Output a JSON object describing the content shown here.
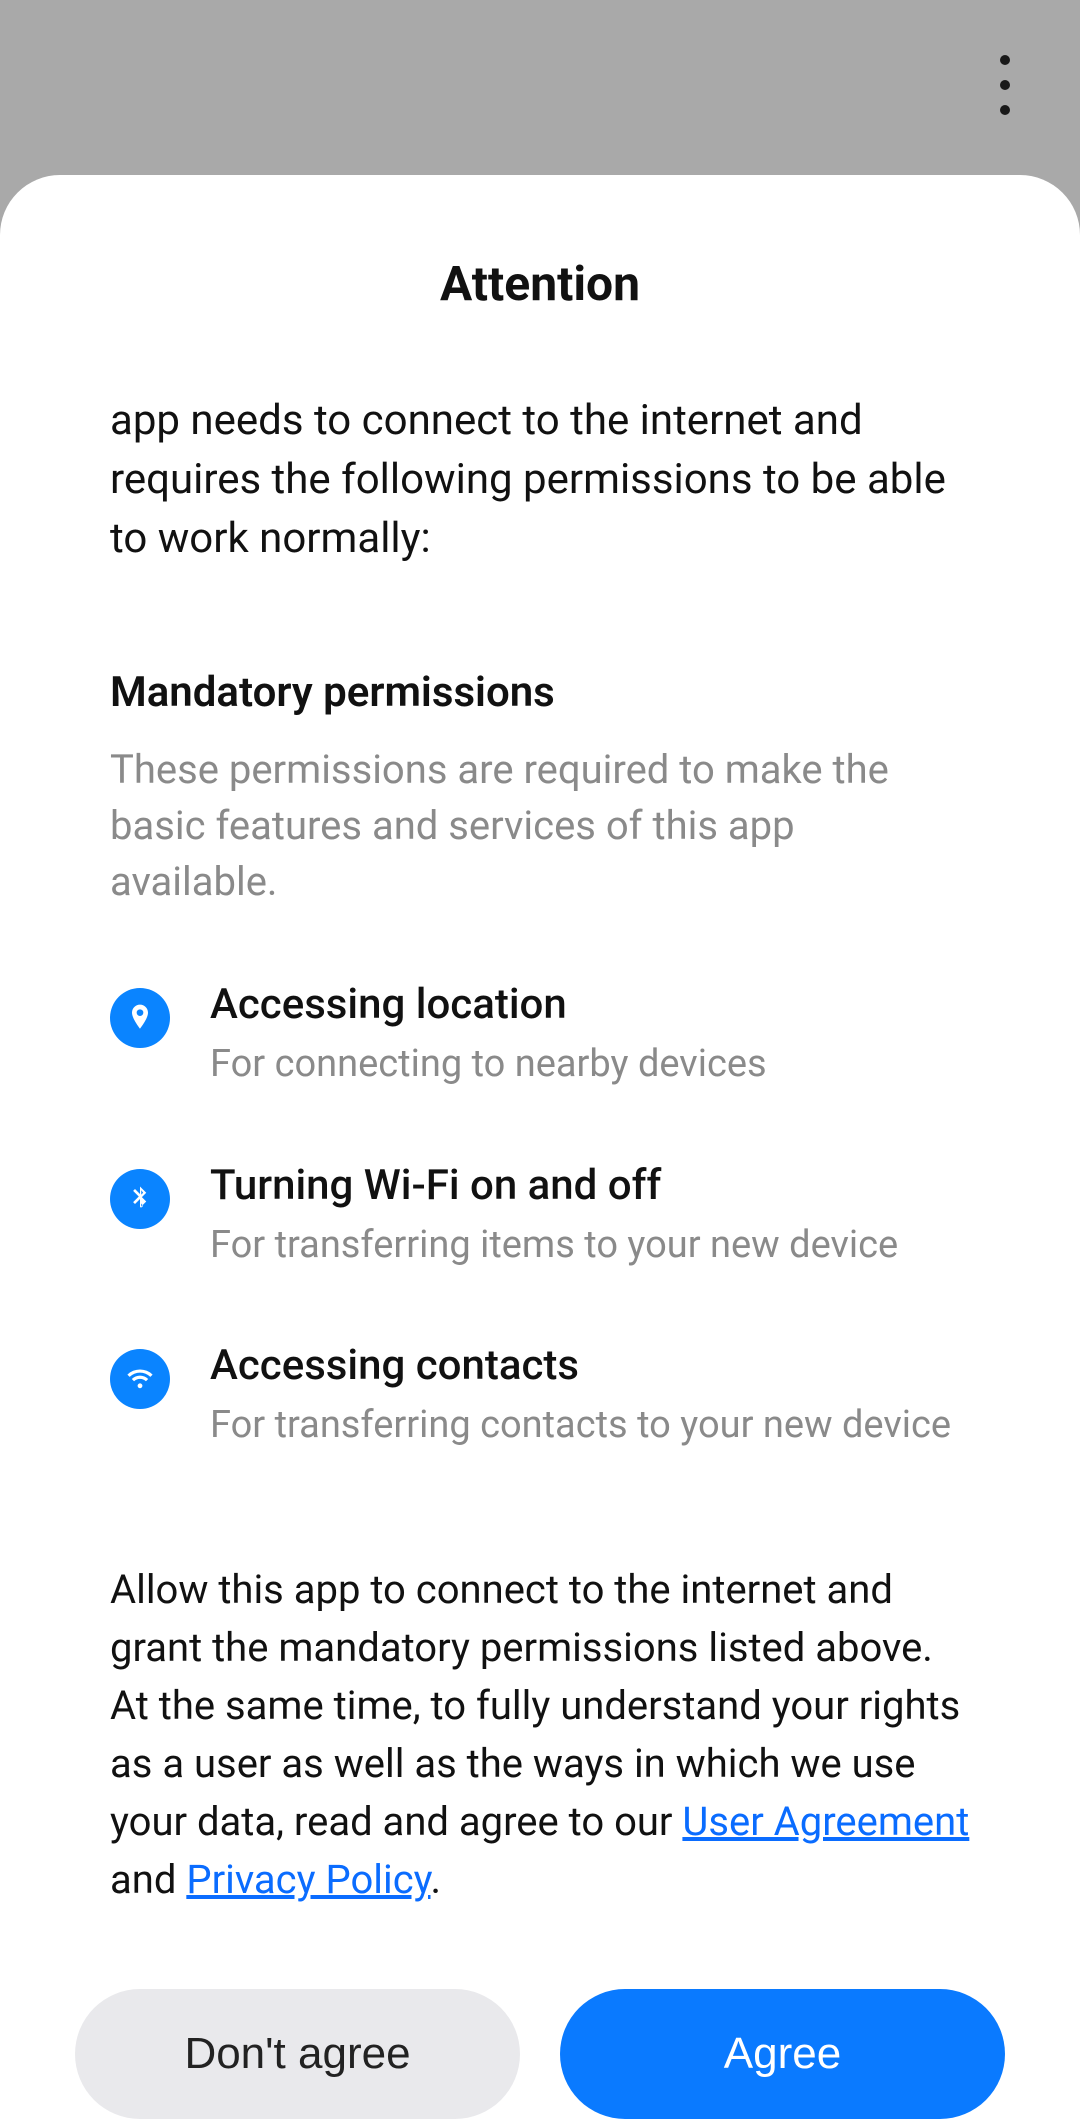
{
  "colors": {
    "accent": "#0a7aff"
  },
  "dialogTitle": "Attention",
  "introText": "app needs to connect to the internet and requires the following permissions to be able to work normally:",
  "sectionTitle": "Mandatory permissions",
  "sectionDesc": "These permissions are required to make the basic features and services of this app available.",
  "permissions": [
    {
      "title": "Accessing location",
      "desc": "For connecting to nearby devices",
      "icon": "location-pin-icon"
    },
    {
      "title": "Turning Wi-Fi on and off",
      "desc": "For transferring items to your new device",
      "icon": "bluetooth-icon"
    },
    {
      "title": "Accessing contacts",
      "desc": "For transferring contacts to your new device",
      "icon": "wifi-icon"
    }
  ],
  "footer": {
    "part1": "Allow this app to connect to the internet and grant the mandatory permissions listed above.",
    "part2a": "At the same time, to fully understand your rights as a user as well as the ways in which we use your data, read and agree to our ",
    "link1": "User Agreement",
    "between": " and ",
    "link2": "Privacy Policy",
    "end": "."
  },
  "buttons": {
    "disagree": "Don't agree",
    "agree": "Agree"
  }
}
